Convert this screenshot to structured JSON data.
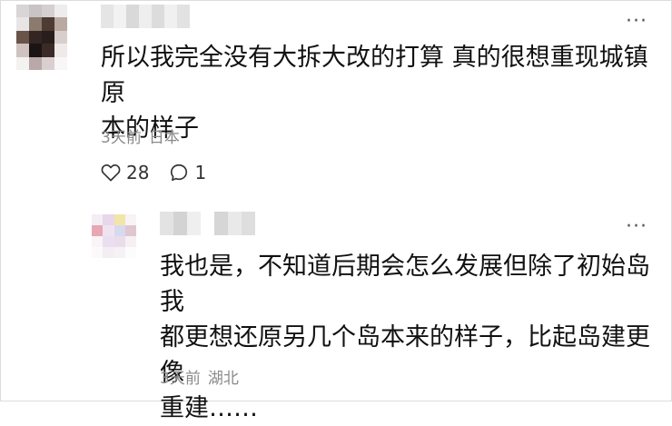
{
  "comment": {
    "text": "所以我完全没有大拆大改的打算 真的很想重现城镇原\n本的样子",
    "time": "3天前",
    "location": "日本",
    "likes": "28",
    "replies": "1",
    "more": "···"
  },
  "reply": {
    "text": "我也是，不知道后期会怎么发展但除了初始岛我\n都更想还原另几个岛本来的样子，比起岛建更像\n重建……",
    "time": "3天前",
    "location": "湖北",
    "more": "···"
  },
  "icons": {
    "like": "heart-icon",
    "comment": "comment-bubble-icon",
    "more": "more-dots-icon"
  },
  "colors": {
    "text": "#111111",
    "meta": "#8a8a8a",
    "border": "#dcdcdc",
    "background": "#ffffff"
  }
}
